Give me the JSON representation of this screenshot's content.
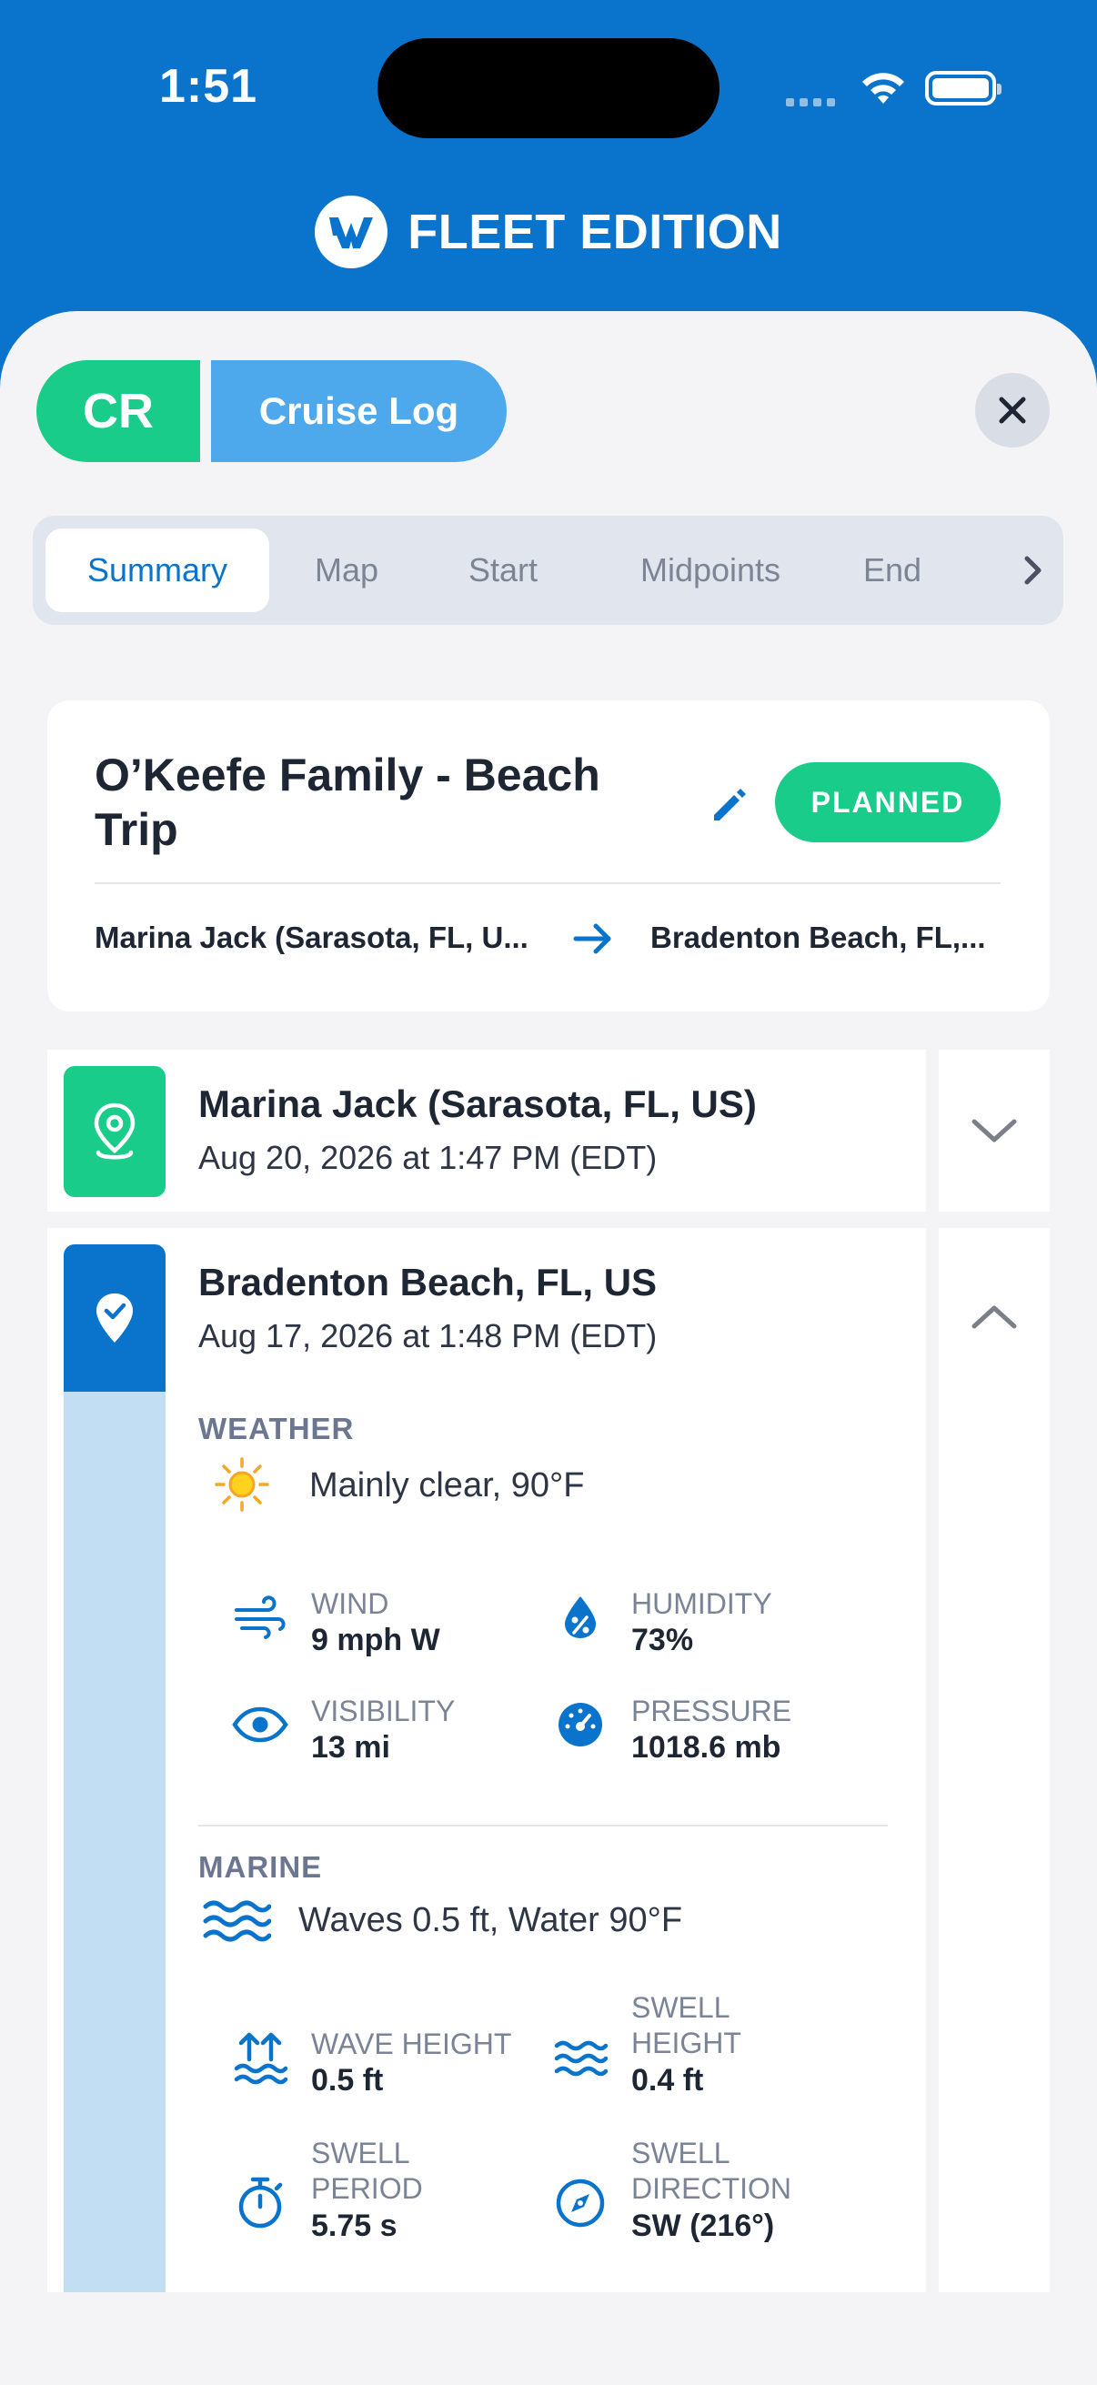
{
  "status_bar": {
    "time": "1:51"
  },
  "brand": {
    "name": "FLEET EDITION"
  },
  "header": {
    "badge": "CR",
    "label": "Cruise Log"
  },
  "tabs": [
    {
      "label": "Summary",
      "active": true
    },
    {
      "label": "Map"
    },
    {
      "label": "Start"
    },
    {
      "label": "Midpoints"
    },
    {
      "label": "End"
    }
  ],
  "trip": {
    "title": "O’Keefe Family - Beach Trip",
    "status": "PLANNED",
    "from": "Marina Jack (Sarasota, FL, U...",
    "to": "Bradenton Beach, FL,..."
  },
  "stops": [
    {
      "name": "Marina Jack (Sarasota, FL, US)",
      "time": "Aug 20, 2026 at 1:47 PM (EDT)",
      "expanded": false
    },
    {
      "name": "Bradenton Beach, FL, US",
      "time": "Aug 17, 2026 at 1:48 PM (EDT)",
      "expanded": true,
      "weather": {
        "heading": "WEATHER",
        "summary": "Mainly clear, 90°F",
        "wind": {
          "label": "WIND",
          "value": "9 mph W"
        },
        "humidity": {
          "label": "HUMIDITY",
          "value": "73%"
        },
        "visibility": {
          "label": "VISIBILITY",
          "value": "13 mi"
        },
        "pressure": {
          "label": "PRESSURE",
          "value": "1018.6 mb"
        }
      },
      "marine": {
        "heading": "MARINE",
        "summary": "Waves 0.5 ft, Water 90°F",
        "wave_height": {
          "label": "WAVE HEIGHT",
          "value": "0.5 ft"
        },
        "swell_height": {
          "label_1": "SWELL",
          "label_2": "HEIGHT",
          "value": "0.4 ft"
        },
        "swell_period": {
          "label_1": "SWELL",
          "label_2": "PERIOD",
          "value": "5.75 s"
        },
        "swell_direction": {
          "label_1": "SWELL",
          "label_2": "DIRECTION",
          "value": "SW (216°)"
        }
      }
    }
  ],
  "colors": {
    "primary": "#0a74cc",
    "accent_green": "#19cc8a",
    "light_blue": "#4ea8ec",
    "rail_blue": "#c2def3",
    "background": "#f4f4f6"
  },
  "icons": [
    "w-logo-icon",
    "close-icon",
    "chevron-right-icon",
    "pencil-icon",
    "arrow-right-icon",
    "map-pin-icon",
    "check-pin-icon",
    "sun-icon",
    "wind-icon",
    "humidity-drop-icon",
    "eye-icon",
    "gauge-icon",
    "waves-icon",
    "wave-height-icon",
    "swell-icon",
    "stopwatch-icon",
    "compass-icon",
    "chevron-down-icon",
    "chevron-up-icon"
  ]
}
